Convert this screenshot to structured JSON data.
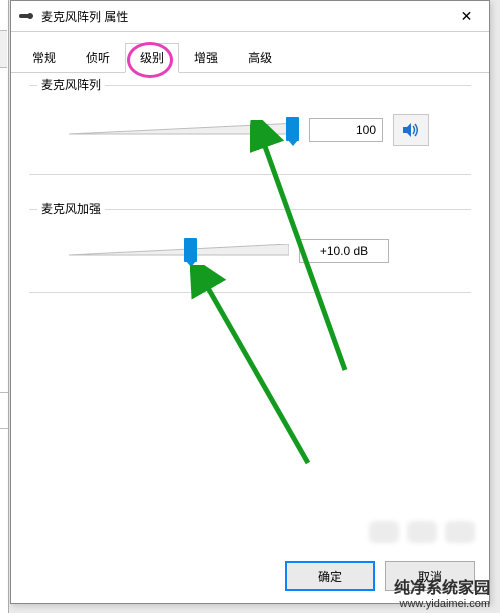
{
  "window": {
    "title": "麦克风阵列 属性",
    "close_glyph": "✕"
  },
  "tabs": [
    {
      "label": "常规"
    },
    {
      "label": "侦听"
    },
    {
      "label": "级别",
      "active": true
    },
    {
      "label": "增强"
    },
    {
      "label": "高级"
    }
  ],
  "groups": {
    "mic_array": {
      "title": "麦克风阵列",
      "value": "100",
      "slider_pos_percent": 100
    },
    "mic_boost": {
      "title": "麦克风加强",
      "value": "+10.0 dB",
      "slider_pos_percent": 55
    }
  },
  "buttons": {
    "ok": "确定",
    "cancel": "取消"
  },
  "icons": {
    "speaker": "speaker-icon",
    "mic_title": "mic-icon"
  },
  "watermark": {
    "line1": "纯净系统家园",
    "line2": "www.yidaimei.com"
  },
  "colors": {
    "accent": "#0a8cde",
    "highlight_ring": "#e83fb8",
    "arrow": "#149b1f"
  }
}
